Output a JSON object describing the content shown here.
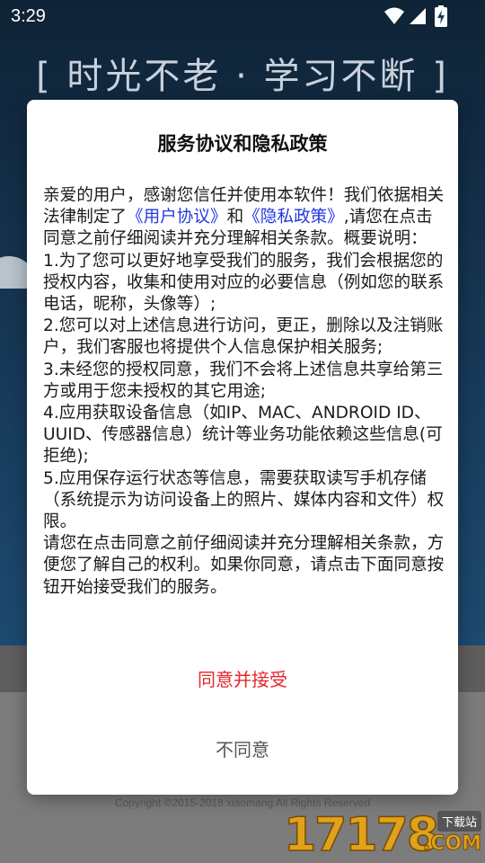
{
  "status_bar": {
    "time": "3:29"
  },
  "background": {
    "slogan": "[ 时光不老 · 学习不断 ]",
    "copyright": "Copyright ©2015-2018 xiaomang  All Rights Reserved"
  },
  "dialog": {
    "title": "服务协议和隐私政策",
    "intro_before": "亲爱的用户，感谢您信任并使用本软件！我们依据相关法律制定了",
    "user_agreement_link": "《用户协议》",
    "and_text": "和",
    "privacy_policy_link": "《隐私政策》",
    "intro_after": ",请您在点击同意之前仔细阅读并充分理解相关条款。概要说明：",
    "item_1": "1.为了您可以更好地享受我们的服务，我们会根据您的授权内容，收集和使用对应的必要信息（例如您的联系电话，昵称，头像等）;",
    "item_2": "2.您可以对上述信息进行访问，更正，删除以及注销账户，我们客服也将提供个人信息保护相关服务;",
    "item_3": "3.未经您的授权同意，我们不会将上述信息共享给第三方或用于您未授权的其它用途;",
    "item_4": "4.应用获取设备信息（如IP、MAC、ANDROID ID、UUID、传感器信息）统计等业务功能依赖这些信息(可拒绝);",
    "item_5": "5.应用保存运行状态等信息，需要获取读写手机存储（系统提示为访问设备上的照片、媒体内容和文件）权限。",
    "closing": "请您在点击同意之前仔细阅读并充分理解相关条款，方便您了解自己的权利。如果你同意，请点击下面同意按钮开始接受我们的服务。",
    "agree_label": "同意并接受",
    "disagree_label": "不同意",
    "colors": {
      "link": "#2237e0",
      "agree": "#e5262a",
      "disagree": "#555555"
    }
  },
  "watermark": {
    "number": "17178",
    "tag": "下载站",
    "suffix": ".COM"
  }
}
